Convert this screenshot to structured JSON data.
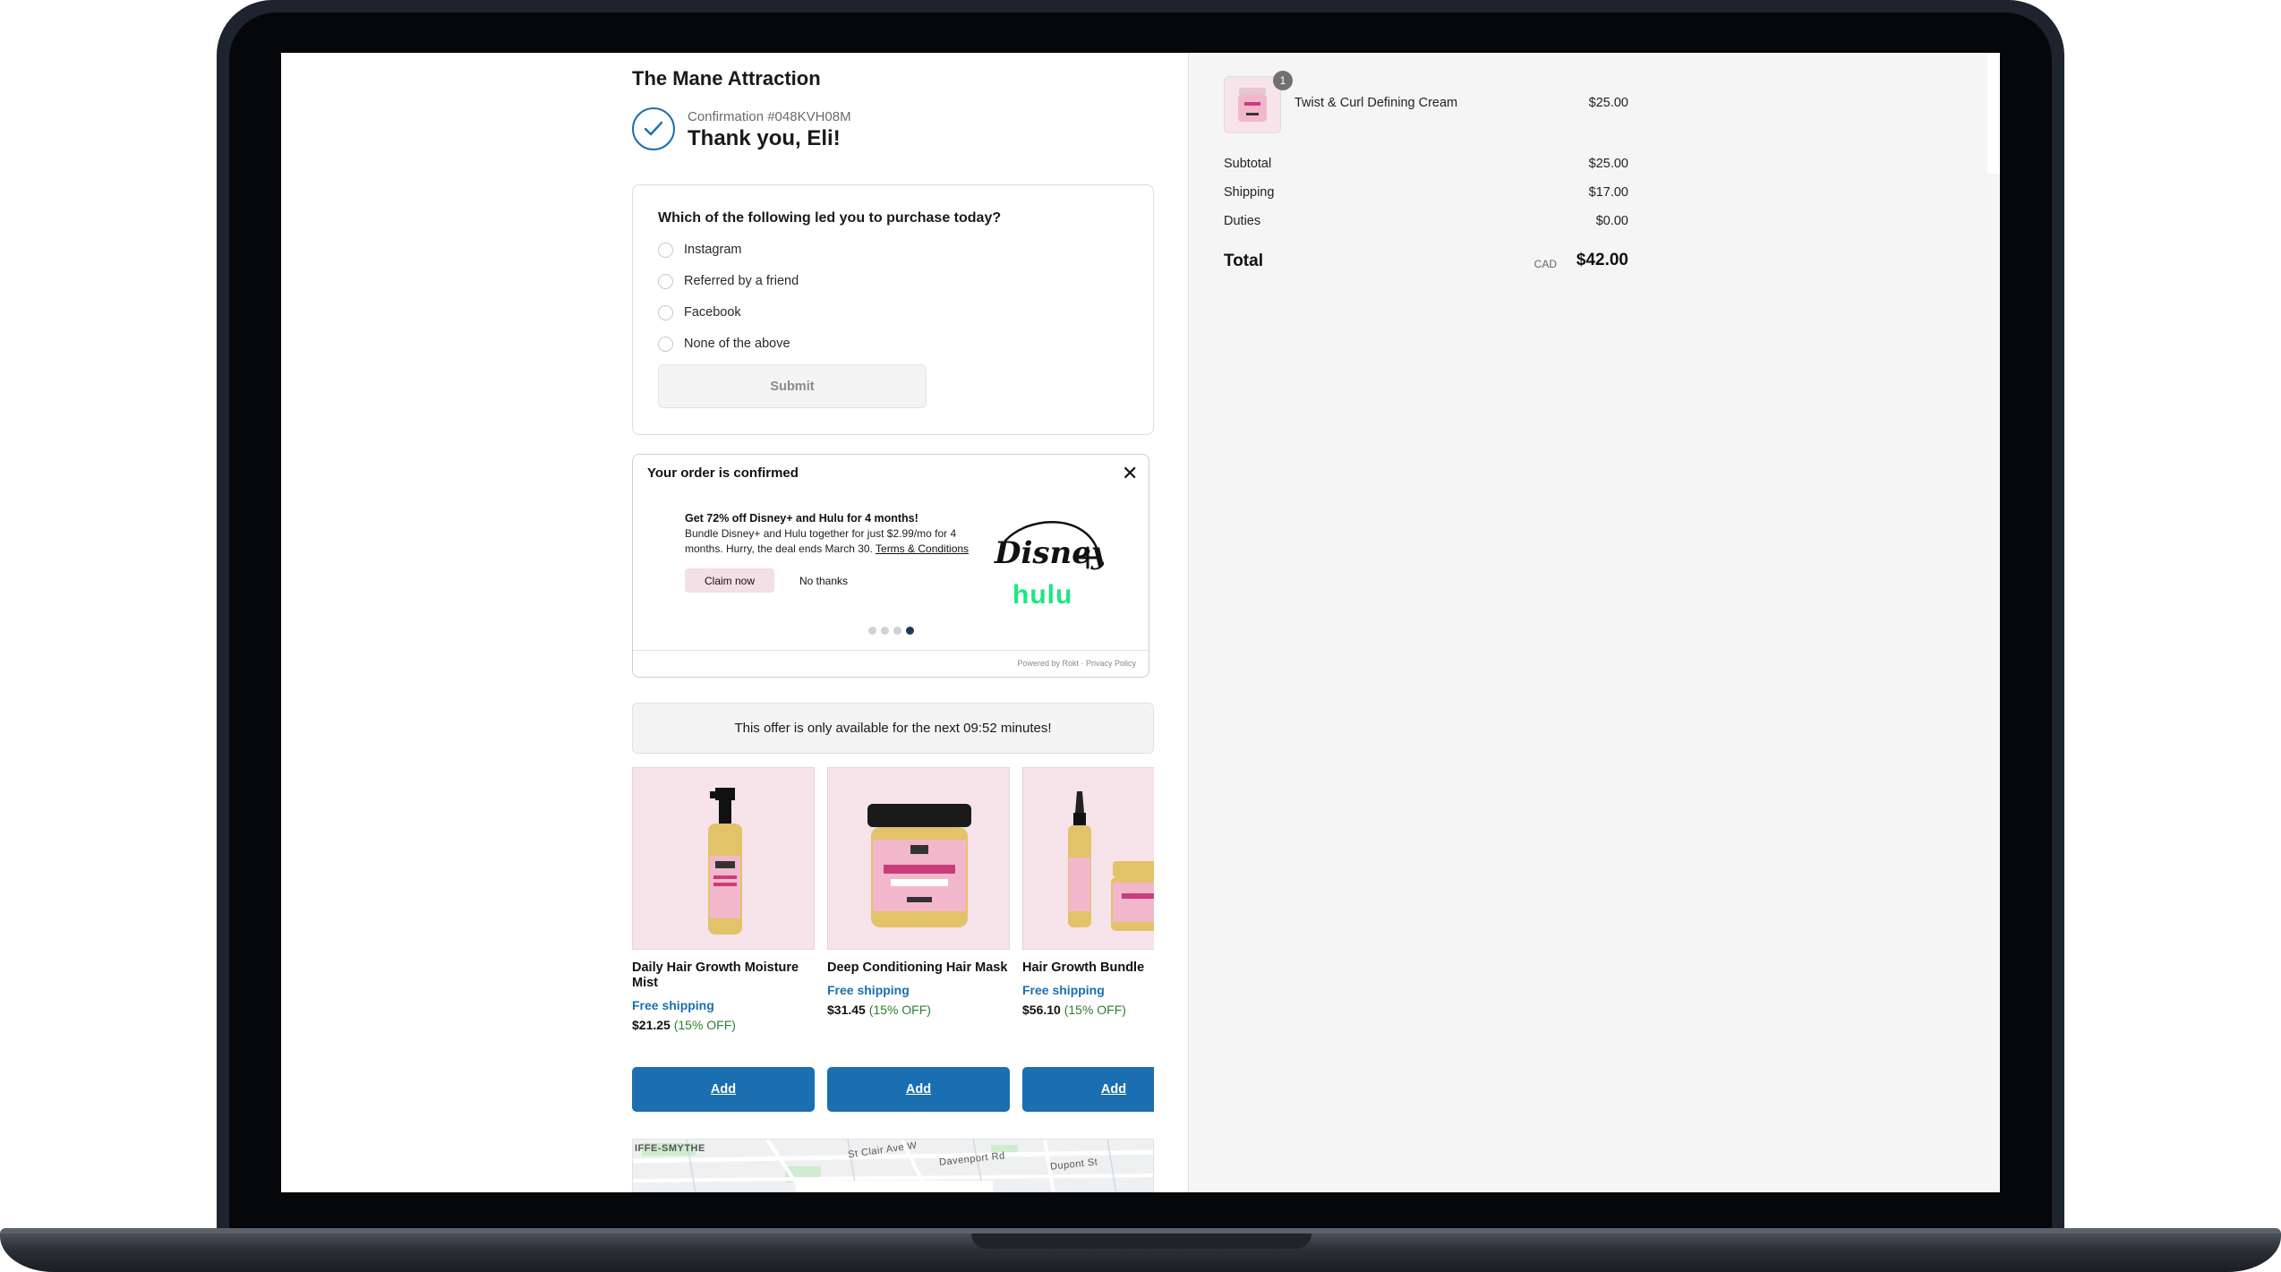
{
  "shop": {
    "name": "The Mane Attraction"
  },
  "confirmation": {
    "number": "Confirmation #048KVH08M",
    "thanks": "Thank you, Eli!"
  },
  "survey": {
    "question": "Which of the following led you to purchase today?",
    "options": [
      "Instagram",
      "Referred by a friend",
      "Facebook",
      "None of the above"
    ],
    "submit_label": "Submit"
  },
  "offer": {
    "header": "Your order is confirmed",
    "title": "Get 72% off Disney+ and Hulu for 4 months!",
    "body": "Bundle Disney+ and Hulu together for just $2.99/mo for 4 months. Hurry, the deal ends March 30.",
    "terms": "Terms & Conditions",
    "claim_label": "Claim now",
    "decline_label": "No thanks",
    "hulu_logo": "hulu",
    "powered": "Powered by Rokt · Privacy Policy",
    "pages": 4,
    "active_page": 4
  },
  "timer": {
    "text": "This offer is only available for the next 09:52 minutes!"
  },
  "products": [
    {
      "name": "Daily Hair Growth Moisture Mist",
      "shipping": "Free shipping",
      "price": "$21.25",
      "discount": "(15% OFF)",
      "add_label": "Add"
    },
    {
      "name": "Deep Conditioning Hair Mask",
      "shipping": "Free shipping",
      "price": "$31.45",
      "discount": "(15% OFF)",
      "add_label": "Add"
    },
    {
      "name": "Hair Growth Bundle",
      "shipping": "Free shipping",
      "price": "$56.10",
      "discount": "(15% OFF)",
      "add_label": "Add"
    }
  ],
  "map": {
    "labels": [
      "IFFE-SMYTHE",
      "St Clair Ave W",
      "Davenport Rd",
      "Dupont St"
    ]
  },
  "summary": {
    "item": {
      "name": "Twist & Curl Defining Cream",
      "price": "$25.00",
      "quantity": "1"
    },
    "subtotal_label": "Subtotal",
    "subtotal": "$25.00",
    "shipping_label": "Shipping",
    "shipping": "$17.00",
    "duties_label": "Duties",
    "duties": "$0.00",
    "total_label": "Total",
    "currency": "CAD",
    "total": "$42.00"
  },
  "colors": {
    "accent": "#1b6fb0",
    "discount": "#2e7d32",
    "hulu": "#1ce783",
    "product_bg": "#f6e4ea"
  }
}
